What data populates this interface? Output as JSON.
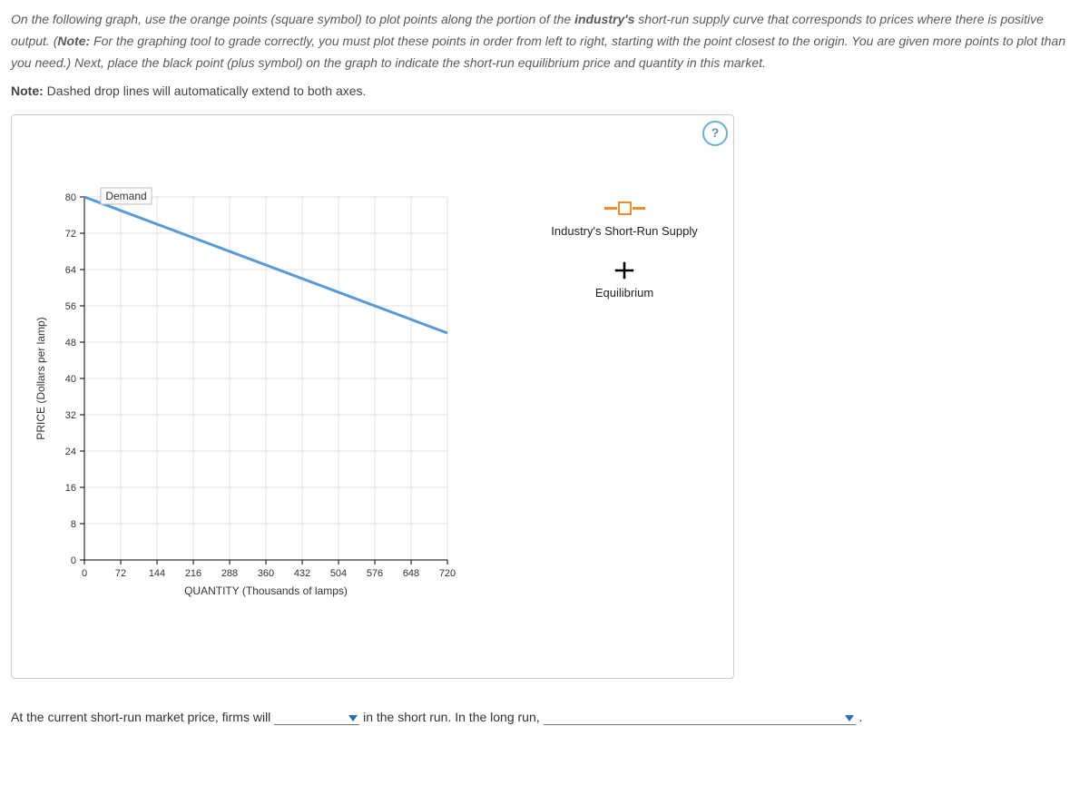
{
  "instructions": {
    "text_pre": "On the following graph, use the orange points (square symbol) to plot points along the portion of the ",
    "bold1": "industry's",
    "text_mid1": " short-run supply curve that corresponds to prices where there is positive output. (",
    "bold2": "Note:",
    "text_mid2": " For the graphing tool to grade correctly, you must plot these points in order from left to right, starting with the point closest to the origin. You are given more points to plot than you need.) Next, place the black point (plus symbol) on the graph to indicate the short-run equilibrium price and quantity in this market."
  },
  "note": {
    "bold": "Note:",
    "text": " Dashed drop lines will automatically extend to both axes."
  },
  "help_label": "?",
  "palette": {
    "supply_label": "Industry's Short-Run Supply",
    "equilibrium_label": "Equilibrium"
  },
  "question": {
    "prefix": "At the current short-run market price, firms will ",
    "middle": " in the short run. In the long run, ",
    "suffix": " ."
  },
  "chart_data": {
    "type": "line",
    "xlabel": "QUANTITY (Thousands of lamps)",
    "ylabel": "PRICE (Dollars per lamp)",
    "xlim": [
      0,
      720
    ],
    "ylim": [
      0,
      80
    ],
    "x_ticks": [
      0,
      72,
      144,
      216,
      288,
      360,
      432,
      504,
      576,
      648,
      720
    ],
    "y_ticks": [
      0,
      8,
      16,
      24,
      32,
      40,
      48,
      56,
      64,
      72,
      80
    ],
    "series": [
      {
        "name": "Demand",
        "x": [
          0,
          720
        ],
        "y": [
          80,
          50
        ]
      }
    ]
  }
}
